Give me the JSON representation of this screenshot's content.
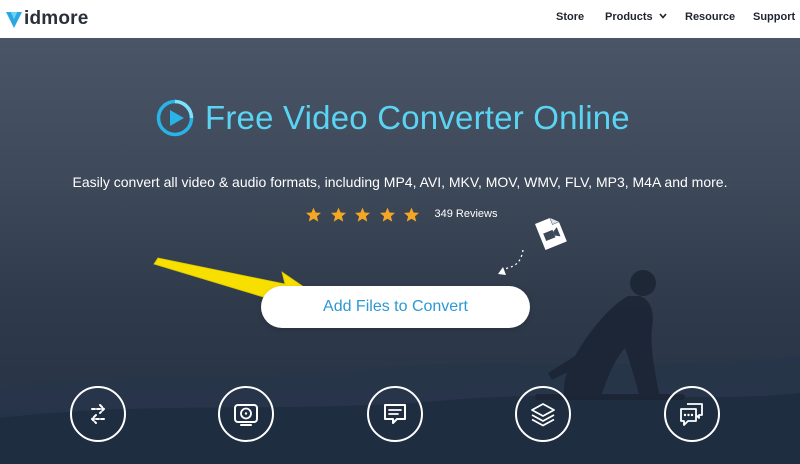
{
  "brand": {
    "logo_text": "idmore",
    "logo_letter": "V"
  },
  "nav": {
    "store": "Store",
    "products": "Products",
    "resource": "Resource",
    "support": "Support"
  },
  "hero": {
    "title": "Free Video Converter Online",
    "subtitle": "Easily convert all video & audio formats, including MP4, AVI, MKV, MOV, WMV, FLV, MP3, M4A and more.",
    "rating": {
      "stars": 5,
      "reviews": "349 Reviews"
    },
    "add_button": "Add Files to Convert"
  },
  "features": [
    {
      "icon": "convert-arrows-icon"
    },
    {
      "icon": "video-reel-icon"
    },
    {
      "icon": "subtitle-chat-icon"
    },
    {
      "icon": "layers-icon"
    },
    {
      "icon": "chat-bubbles-icon"
    }
  ],
  "colors": {
    "accent": "#5ad4f2",
    "button_text": "#2c98d3",
    "star": "#f5a623",
    "arrow": "#f7e000"
  }
}
